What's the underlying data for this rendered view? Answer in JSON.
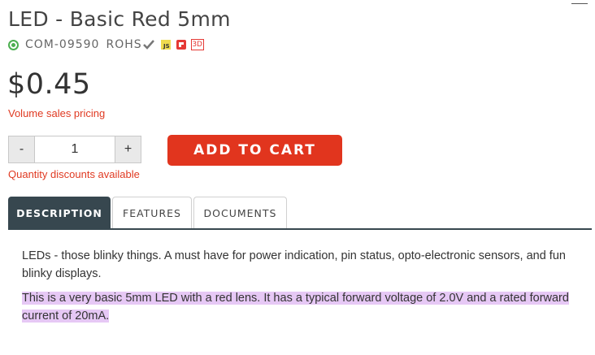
{
  "product": {
    "title": "LED - Basic Red 5mm",
    "sku": "COM-09590",
    "rohs": "ROHS",
    "price": "$0.45",
    "volume_pricing": "Volume sales pricing",
    "quantity": "1",
    "decrement": "-",
    "increment": "+",
    "add_to_cart": "ADD TO CART",
    "quantity_discounts": "Quantity discounts available",
    "icons": {
      "status": "in-stock-dot-icon",
      "rohs": "check-icon",
      "js": "js-icon",
      "fritzing": "fritzing-icon",
      "three_d": "3d-model-icon"
    },
    "js_label": "JS",
    "three_d_label": "3D"
  },
  "tabs": [
    {
      "label": "DESCRIPTION",
      "active": true
    },
    {
      "label": "FEATURES",
      "active": false
    },
    {
      "label": "DOCUMENTS",
      "active": false
    }
  ],
  "description": {
    "p1": "LEDs - those blinky things. A must have for power indication, pin status, opto-electronic sensors, and fun blinky displays.",
    "p2": "This is a very basic 5mm LED with a red lens. It has a typical forward voltage of 2.0V and a rated forward current of 20mA."
  },
  "colors": {
    "accent": "#e1351e",
    "link_red": "#e03a22",
    "active_tab": "#37474f",
    "highlight": "#e6c8f5",
    "in_stock": "#4caf50"
  }
}
